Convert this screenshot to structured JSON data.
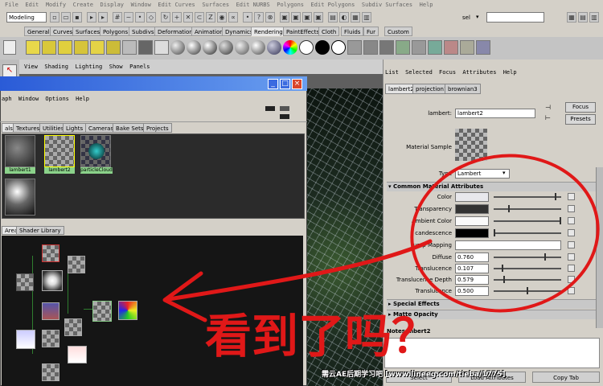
{
  "menubar": {
    "items": [
      "File",
      "Edit",
      "Modify",
      "Create",
      "Display",
      "Window",
      "Edit Curves",
      "Surfaces",
      "Edit NURBS",
      "Polygons",
      "Edit Polygons",
      "Subdiv Surfaces",
      "Help"
    ]
  },
  "toolbar": {
    "mode": "Modeling",
    "sel_label": "sel",
    "sel_value": ""
  },
  "shelf": {
    "tabs": [
      "General",
      "Curves",
      "Surfaces",
      "Polygons",
      "Subdivs",
      "Deformation",
      "Animation",
      "Dynamics",
      "Rendering",
      "PaintEffects",
      "Cloth",
      "Fluids",
      "Fur",
      "Custom"
    ],
    "active": "Rendering"
  },
  "viewport": {
    "menu": [
      "View",
      "Shading",
      "Lighting",
      "Show",
      "Panels"
    ]
  },
  "hypershade": {
    "menu": [
      "aph",
      "Window",
      "Options",
      "Help"
    ],
    "tabs": [
      "als",
      "Textures",
      "Utilities",
      "Lights",
      "Cameras",
      "Bake Sets",
      "Projects"
    ],
    "swatches": [
      "lambert1",
      "lambert2",
      "particleCloud1"
    ],
    "work_tabs": [
      "Area",
      "Shader Library"
    ]
  },
  "attr_editor": {
    "menu": [
      "List",
      "Selected",
      "Focus",
      "Attributes",
      "Help"
    ],
    "tabs": [
      "lambert2",
      "projection1",
      "brownian3"
    ],
    "node_label": "lambert:",
    "node_name": "lambert2",
    "focus_label": "Focus",
    "presets_label": "Presets",
    "material_sample_label": "Material Sample",
    "type_label": "Type",
    "type_value": "Lambert",
    "section_common": "Common Material Attributes",
    "attrs": [
      {
        "label": "Color",
        "value": ""
      },
      {
        "label": "Transparency",
        "value": ""
      },
      {
        "label": "Ambient Color",
        "value": ""
      },
      {
        "label": "candescence",
        "value": ""
      },
      {
        "label": "ump Mapping",
        "value": ""
      },
      {
        "label": "Diffuse",
        "value": "0.760"
      },
      {
        "label": "Translucence",
        "value": "0.107"
      },
      {
        "label": "Translucence Depth",
        "value": "0.579"
      },
      {
        "label": "Translucence ",
        "value": "0.500"
      }
    ],
    "section_special": "Special Effects",
    "section_matte": "Matte Opacity",
    "notes_label": "Notes:",
    "notes_value": "mbert2",
    "select_label": "Select",
    "load_attr_label": "Load Attributes",
    "copy_tab_label": "Copy Tab"
  },
  "annotation": {
    "text": "看到了吗？"
  },
  "watermark": "需云AE后期学习吧  [www.lineeg.com/tieba/1775]",
  "colors": {
    "accent_red": "#e01818",
    "titlebar_blue": "#2a5bd7",
    "swatch_label_green": "#8bd28a"
  }
}
